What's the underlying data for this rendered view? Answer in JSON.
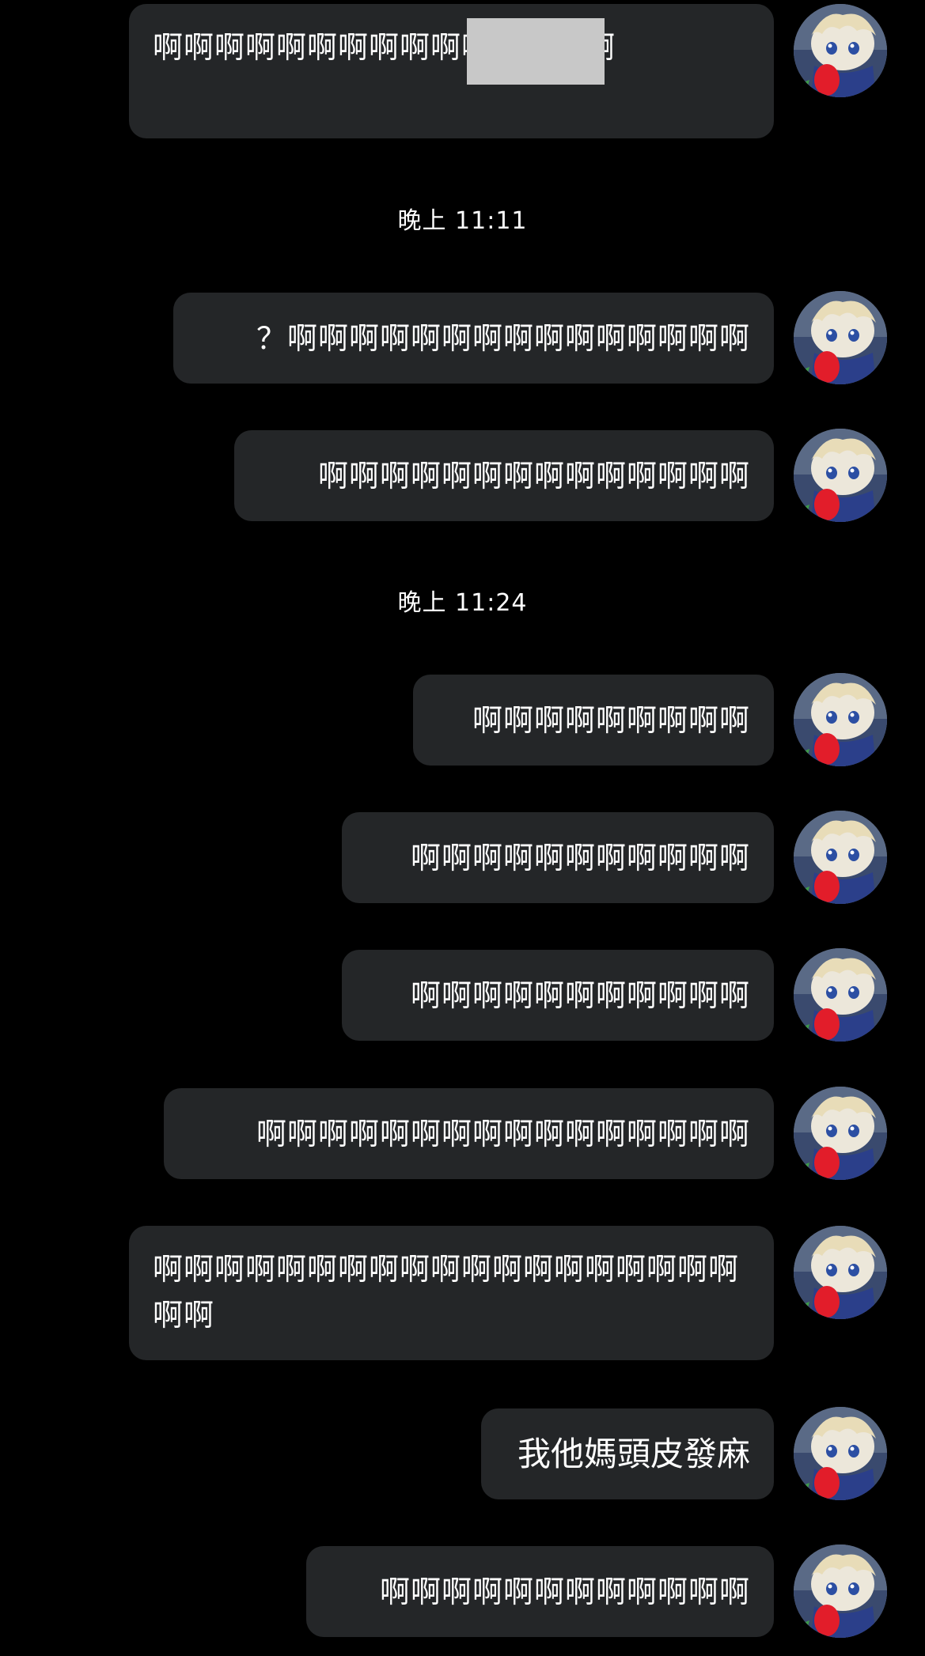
{
  "messages": [
    {
      "text": "啊啊啊啊啊啊啊啊啊啊啊啊啊啊啊",
      "redacted": true
    },
    {
      "text": "？啊啊啊啊啊啊啊啊啊啊啊啊啊啊啊"
    },
    {
      "text": "啊啊啊啊啊啊啊啊啊啊啊啊啊啊"
    },
    {
      "text": "啊啊啊啊啊啊啊啊啊"
    },
    {
      "text": "啊啊啊啊啊啊啊啊啊啊啊"
    },
    {
      "text": "啊啊啊啊啊啊啊啊啊啊啊"
    },
    {
      "text": "啊啊啊啊啊啊啊啊啊啊啊啊啊啊啊啊"
    },
    {
      "text": "啊啊啊啊啊啊啊啊啊啊啊啊啊啊啊啊啊啊啊啊啊"
    },
    {
      "text": "我他媽頭皮發麻"
    },
    {
      "text": "啊啊啊啊啊啊啊啊啊啊啊啊"
    }
  ],
  "timestamps": [
    {
      "text": "晚上 11:11"
    },
    {
      "text": "晚上 11:24"
    }
  ],
  "theme": {
    "background": "#000000",
    "bubble": "#242628",
    "text": "#ffffff",
    "redaction": "#c8c8c8"
  },
  "avatar_icon": "plush-doll-avatar-icon"
}
